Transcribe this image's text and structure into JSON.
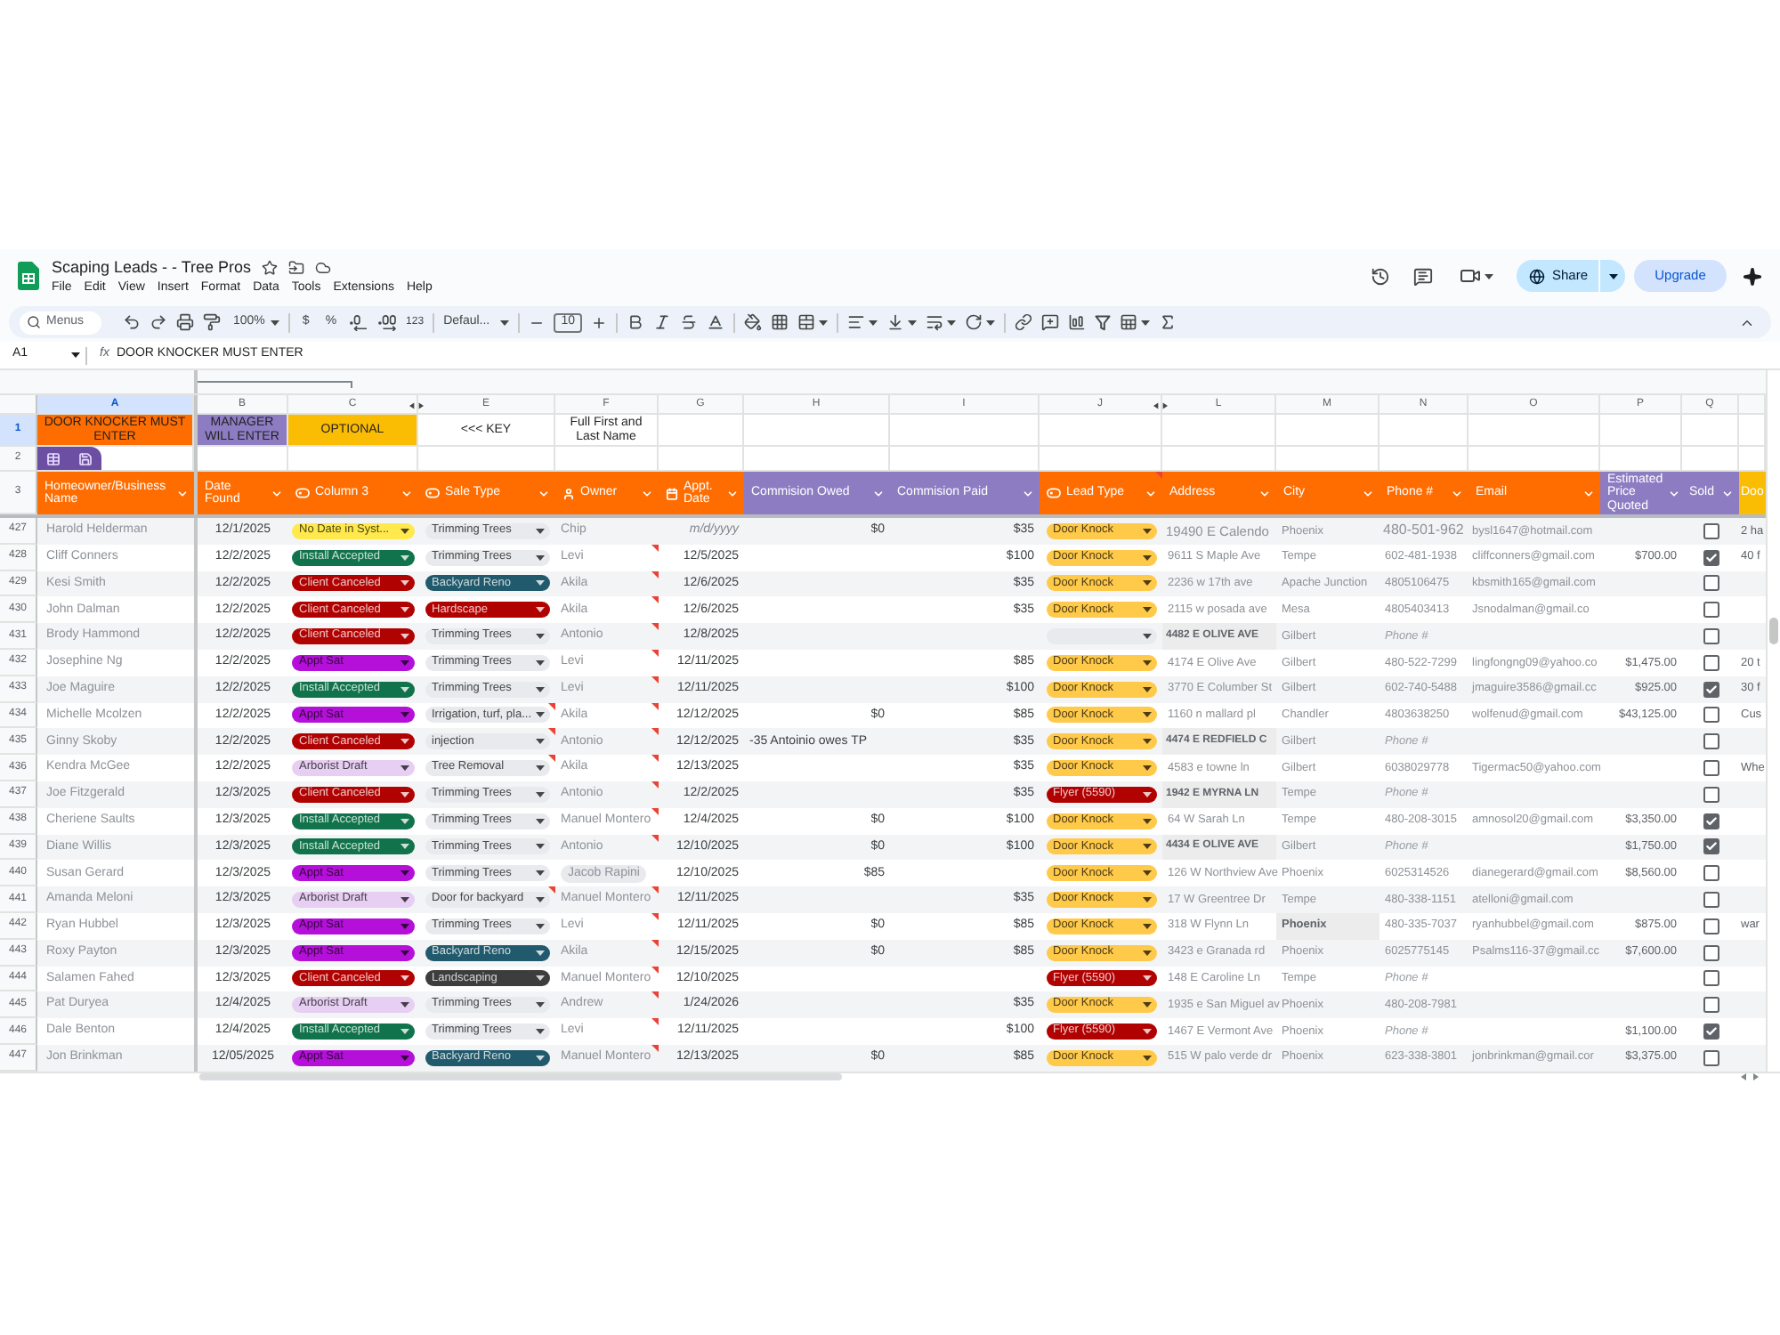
{
  "app": {
    "title": "Scaping Leads - - Tree Pros",
    "menu": [
      "File",
      "Edit",
      "View",
      "Insert",
      "Format",
      "Data",
      "Tools",
      "Extensions",
      "Help"
    ],
    "share": "Share",
    "upgrade": "Upgrade"
  },
  "toolbar": {
    "search": {
      "placeholder": "Menus"
    },
    "zoom": "100%",
    "currency": "$",
    "percent": "%",
    "number_format": "123",
    "font": "Defaul...",
    "font_size": "10"
  },
  "formula_bar": {
    "cell": "A1",
    "function_label": "fx",
    "content": "DOOR KNOCKER MUST ENTER"
  },
  "columns": [
    {
      "letter": "A",
      "selected": true,
      "hidden_after": false
    },
    {
      "letter": "B",
      "selected": false,
      "hidden_after": false
    },
    {
      "letter": "C",
      "selected": false,
      "hidden_after": true
    },
    {
      "letter": "E",
      "selected": false,
      "hidden_after": false
    },
    {
      "letter": "F",
      "selected": false,
      "hidden_after": false
    },
    {
      "letter": "G",
      "selected": false,
      "hidden_after": false
    },
    {
      "letter": "H",
      "selected": false,
      "hidden_after": false
    },
    {
      "letter": "I",
      "selected": false,
      "hidden_after": false
    },
    {
      "letter": "J",
      "selected": false,
      "hidden_after": true
    },
    {
      "letter": "L",
      "selected": false,
      "hidden_after": false
    },
    {
      "letter": "M",
      "selected": false,
      "hidden_after": false
    },
    {
      "letter": "N",
      "selected": false,
      "hidden_after": false
    },
    {
      "letter": "O",
      "selected": false,
      "hidden_after": false
    },
    {
      "letter": "P",
      "selected": false,
      "hidden_after": false
    },
    {
      "letter": "Q",
      "selected": false,
      "hidden_after": false
    }
  ],
  "key_row": {
    "number": "1",
    "selected": true,
    "cells": [
      {
        "text": "DOOR KNOCKER MUST ENTER",
        "color": "#ff6d01"
      },
      {
        "text": "MANAGER WILL ENTER",
        "color": "#8e7cc3"
      },
      {
        "text": "OPTIONAL",
        "color": "#fbbc04"
      },
      {
        "text": "<<< KEY"
      },
      {
        "text": "Full First and Last Name"
      }
    ]
  },
  "spacer_row": {
    "number": "2",
    "selected": false
  },
  "header_row": {
    "number": "3",
    "selected": false,
    "cells": [
      {
        "label": "Homeowner/Business Name",
        "color": "#ff6d01",
        "kind": "plain",
        "note": false,
        "dropdown": true
      },
      {
        "label": "Date Found",
        "color": "#ff6d01",
        "kind": "plain",
        "note": false,
        "dropdown": true
      },
      {
        "label": "Column 3",
        "color": "#ff6d01",
        "kind": "chip",
        "note": false,
        "dropdown": true
      },
      {
        "label": "Sale Type",
        "color": "#ff6d01",
        "kind": "chip",
        "note": false,
        "dropdown": true
      },
      {
        "label": "Owner",
        "color": "#ff6d01",
        "kind": "person",
        "note": false,
        "dropdown": true
      },
      {
        "label": "Appt. Date",
        "color": "#ff6d01",
        "kind": "calendar",
        "note": false,
        "dropdown": true
      },
      {
        "label": "Commision Owed",
        "color": "#8e7cc3",
        "kind": "plain",
        "note": false,
        "dropdown": true
      },
      {
        "label": "Commision Paid",
        "color": "#8e7cc3",
        "kind": "plain",
        "note": false,
        "dropdown": true
      },
      {
        "label": "Lead Type",
        "color": "#ff6d01",
        "kind": "chip",
        "note": true,
        "dropdown": true
      },
      {
        "label": "Address",
        "color": "#ff6d01",
        "kind": "plain",
        "note": false,
        "dropdown": true
      },
      {
        "label": "City",
        "color": "#ff6d01",
        "kind": "plain",
        "note": false,
        "dropdown": true
      },
      {
        "label": "Phone #",
        "color": "#ff6d01",
        "kind": "plain",
        "note": false,
        "dropdown": true
      },
      {
        "label": "Email",
        "color": "#ff6d01",
        "kind": "plain",
        "note": false,
        "dropdown": true
      },
      {
        "label": "Estimated Price Quoted",
        "color": "#8e7cc3",
        "kind": "plain",
        "note": false,
        "dropdown": true
      },
      {
        "label": "Sold",
        "color": "#8e7cc3",
        "kind": "plain",
        "note": false,
        "dropdown": true
      },
      {
        "label": "Doo",
        "color": "#fbbc04",
        "kind": "plain",
        "note": false,
        "dropdown": false
      }
    ]
  },
  "rows": [
    {
      "number": "427",
      "selected": false,
      "name": "Harold Helderman",
      "date_found": "12/1/2025",
      "status": {
        "label": "No Date in Syst...",
        "color": "#ffe94d"
      },
      "sale_type": {
        "label": "Trimming Trees",
        "color": "#e8eaed"
      },
      "sale_note": false,
      "owner": {
        "name": "Chip",
        "kind": "text"
      },
      "owner_note": false,
      "appt_date": {
        "text": "m/d/yyyy",
        "kind": "hint"
      },
      "owed": {
        "text": "$0",
        "kind": "number"
      },
      "paid": "$35",
      "lead_type": {
        "label": "Door Knock",
        "color": "#ffc94a"
      },
      "address": {
        "text": "19490 E Calendo",
        "kind": "large"
      },
      "city": {
        "text": "Phoenix",
        "kind": "plain"
      },
      "phone": {
        "text": "480-501-962",
        "kind": "large"
      },
      "email": "bysl1647@hotmail.com",
      "sold": false,
      "notes": "2 ha"
    },
    {
      "number": "428",
      "selected": false,
      "name": "Cliff Conners",
      "date_found": "12/2/2025",
      "status": {
        "label": "Install Accepted",
        "color": "#11734b"
      },
      "sale_type": {
        "label": "Trimming Trees",
        "color": "#e8eaed"
      },
      "sale_note": false,
      "owner": {
        "name": "Levi",
        "kind": "text"
      },
      "owner_note": true,
      "appt_date": {
        "text": "12/5/2025",
        "kind": "date"
      },
      "paid": "$100",
      "lead_type": {
        "label": "Door Knock",
        "color": "#ffc94a"
      },
      "address": {
        "text": "9611 S Maple Ave",
        "kind": "plain"
      },
      "city": {
        "text": "Tempe",
        "kind": "plain"
      },
      "phone": {
        "text": "602-481-1938",
        "kind": "plain"
      },
      "email": "cliffconners@gmail.com",
      "price": "$700.00",
      "sold": true,
      "notes": "40 f"
    },
    {
      "number": "429",
      "selected": false,
      "name": "Kesi Smith",
      "date_found": "12/2/2025",
      "status": {
        "label": "Client Canceled",
        "color": "#b10202"
      },
      "sale_type": {
        "label": "Backyard Reno",
        "color": "#215a6c"
      },
      "sale_note": false,
      "owner": {
        "name": "Akila",
        "kind": "text"
      },
      "owner_note": true,
      "appt_date": {
        "text": "12/6/2025",
        "kind": "date"
      },
      "paid": "$35",
      "lead_type": {
        "label": "Door Knock",
        "color": "#ffc94a"
      },
      "address": {
        "text": "2236 w 17th ave",
        "kind": "plain"
      },
      "city": {
        "text": "Apache Junction",
        "kind": "plain"
      },
      "phone": {
        "text": "4805106475",
        "kind": "plain"
      },
      "email": "kbsmith165@gmail.com",
      "sold": false
    },
    {
      "number": "430",
      "selected": false,
      "name": "John Dalman",
      "date_found": "12/2/2025",
      "status": {
        "label": "Client Canceled",
        "color": "#b10202"
      },
      "sale_type": {
        "label": "Hardscape",
        "color": "#b10202"
      },
      "sale_note": false,
      "owner": {
        "name": "Akila",
        "kind": "text"
      },
      "owner_note": true,
      "appt_date": {
        "text": "12/6/2025",
        "kind": "date"
      },
      "paid": "$35",
      "lead_type": {
        "label": "Door Knock",
        "color": "#ffc94a"
      },
      "address": {
        "text": "2115 w posada ave",
        "kind": "plain"
      },
      "city": {
        "text": "Mesa",
        "kind": "plain"
      },
      "phone": {
        "text": "4805403413",
        "kind": "plain"
      },
      "email": "Jsnodalman@gmail.co",
      "sold": false
    },
    {
      "number": "431",
      "selected": false,
      "name": "Brody Hammond",
      "date_found": "12/2/2025",
      "status": {
        "label": "Client Canceled",
        "color": "#b10202"
      },
      "sale_type": {
        "label": "Trimming Trees",
        "color": "#e8eaed"
      },
      "sale_note": false,
      "owner": {
        "name": "Antonio",
        "kind": "text"
      },
      "owner_note": true,
      "appt_date": {
        "text": "12/8/2025",
        "kind": "date"
      },
      "lead_type": {
        "color": "#e8eaed"
      },
      "address": {
        "text": "4482 E OLIVE AVE",
        "kind": "bold"
      },
      "city": {
        "text": "Gilbert",
        "kind": "plain"
      },
      "phone": {
        "text": "Phone #",
        "kind": "hint"
      },
      "sold": false
    },
    {
      "number": "432",
      "selected": false,
      "name": "Josephine Ng",
      "date_found": "12/2/2025",
      "status": {
        "label": "Appt Sat",
        "color": "#b410d9"
      },
      "sale_type": {
        "label": "Trimming Trees",
        "color": "#e8eaed"
      },
      "sale_note": false,
      "owner": {
        "name": "Levi",
        "kind": "text"
      },
      "owner_note": true,
      "appt_date": {
        "text": "12/11/2025",
        "kind": "date"
      },
      "paid": "$85",
      "lead_type": {
        "label": "Door Knock",
        "color": "#ffc94a"
      },
      "address": {
        "text": "4174 E Olive Ave",
        "kind": "plain"
      },
      "city": {
        "text": "Gilbert",
        "kind": "plain"
      },
      "phone": {
        "text": "480-522-7299",
        "kind": "plain"
      },
      "email": "lingfongng09@yahoo.co",
      "price": "$1,475.00",
      "sold": false,
      "notes": "20 t"
    },
    {
      "number": "433",
      "selected": false,
      "name": "Joe Maguire",
      "date_found": "12/2/2025",
      "status": {
        "label": "Install Accepted",
        "color": "#11734b"
      },
      "sale_type": {
        "label": "Trimming Trees",
        "color": "#e8eaed"
      },
      "sale_note": false,
      "owner": {
        "name": "Levi",
        "kind": "text"
      },
      "owner_note": true,
      "appt_date": {
        "text": "12/11/2025",
        "kind": "date"
      },
      "paid": "$100",
      "lead_type": {
        "label": "Door Knock",
        "color": "#ffc94a"
      },
      "address": {
        "text": "3770 E Columber St",
        "kind": "plain"
      },
      "city": {
        "text": "Gilbert",
        "kind": "plain"
      },
      "phone": {
        "text": "602-740-5488",
        "kind": "plain"
      },
      "email": "jmaguire3586@gmail.cc",
      "price": "$925.00",
      "sold": true,
      "notes": "30 f"
    },
    {
      "number": "434",
      "selected": false,
      "name": "Michelle Mcolzen",
      "date_found": "12/2/2025",
      "status": {
        "label": "Appt Sat",
        "color": "#b410d9"
      },
      "sale_type": {
        "label": "Irrigation, turf, pla...",
        "color": "#e8eaed"
      },
      "sale_note": true,
      "owner": {
        "name": "Akila",
        "kind": "text"
      },
      "owner_note": true,
      "appt_date": {
        "text": "12/12/2025",
        "kind": "date"
      },
      "owed": {
        "text": "$0",
        "kind": "number"
      },
      "paid": "$85",
      "lead_type": {
        "label": "Door Knock",
        "color": "#ffc94a"
      },
      "address": {
        "text": "1160 n mallard pl",
        "kind": "plain"
      },
      "city": {
        "text": "Chandler",
        "kind": "plain"
      },
      "phone": {
        "text": "4803638250",
        "kind": "plain"
      },
      "email": "wolfenud@gmail.com",
      "price": "$43,125.00",
      "sold": false,
      "notes": "Cus"
    },
    {
      "number": "435",
      "selected": false,
      "name": "Ginny Skoby",
      "date_found": "12/2/2025",
      "status": {
        "label": "Client Canceled",
        "color": "#b10202"
      },
      "sale_type": {
        "label": "injection",
        "color": "#e8eaed"
      },
      "sale_note": true,
      "owner": {
        "name": "Antonio",
        "kind": "text"
      },
      "owner_note": true,
      "appt_date": {
        "text": "12/12/2025",
        "kind": "date"
      },
      "owed": {
        "text": "-35 Antoinio owes TP",
        "kind": "text"
      },
      "paid": "$35",
      "lead_type": {
        "label": "Door Knock",
        "color": "#ffc94a"
      },
      "address": {
        "text": "4474 E REDFIELD C",
        "kind": "bold"
      },
      "city": {
        "text": "Gilbert",
        "kind": "plain"
      },
      "phone": {
        "text": "Phone #",
        "kind": "hint"
      },
      "sold": false
    },
    {
      "number": "436",
      "selected": false,
      "name": "Kendra McGee",
      "date_found": "12/2/2025",
      "status": {
        "label": "Arborist Draft",
        "color": "#e6cff2"
      },
      "sale_type": {
        "label": "Tree Removal",
        "color": "#e8eaed"
      },
      "sale_note": true,
      "owner": {
        "name": "Akila",
        "kind": "text"
      },
      "owner_note": true,
      "appt_date": {
        "text": "12/13/2025",
        "kind": "date"
      },
      "paid": "$35",
      "lead_type": {
        "label": "Door Knock",
        "color": "#ffc94a"
      },
      "address": {
        "text": "4583 e towne ln",
        "kind": "plain"
      },
      "city": {
        "text": "Gilbert",
        "kind": "plain"
      },
      "phone": {
        "text": "6038029778",
        "kind": "plain"
      },
      "email": "Tigermac50@yahoo.com",
      "sold": false,
      "notes": "Whe"
    },
    {
      "number": "437",
      "selected": false,
      "name": "Joe Fitzgerald",
      "date_found": "12/3/2025",
      "status": {
        "label": "Client Canceled",
        "color": "#b10202"
      },
      "sale_type": {
        "label": "Trimming Trees",
        "color": "#e8eaed"
      },
      "sale_note": false,
      "owner": {
        "name": "Antonio",
        "kind": "text"
      },
      "owner_note": true,
      "appt_date": {
        "text": "12/2/2025",
        "kind": "date"
      },
      "paid": "$35",
      "lead_type": {
        "label": "Flyer (5590)",
        "color": "#b10202"
      },
      "address": {
        "text": "1942 E MYRNA LN",
        "kind": "bold"
      },
      "city": {
        "text": "Tempe",
        "kind": "plain"
      },
      "phone": {
        "text": "Phone #",
        "kind": "hint"
      },
      "sold": false
    },
    {
      "number": "438",
      "selected": false,
      "name": "Cheriene Saults",
      "date_found": "12/3/2025",
      "status": {
        "label": "Install Accepted",
        "color": "#11734b"
      },
      "sale_type": {
        "label": "Trimming Trees",
        "color": "#e8eaed"
      },
      "sale_note": false,
      "owner": {
        "name": "Manuel Montero",
        "kind": "text"
      },
      "owner_note": true,
      "appt_date": {
        "text": "12/4/2025",
        "kind": "date"
      },
      "owed": {
        "text": "$0",
        "kind": "number"
      },
      "paid": "$100",
      "lead_type": {
        "label": "Door Knock",
        "color": "#ffc94a"
      },
      "address": {
        "text": "64 W Sarah Ln",
        "kind": "plain"
      },
      "city": {
        "text": "Tempe",
        "kind": "plain"
      },
      "phone": {
        "text": "480-208-3015",
        "kind": "plain"
      },
      "email": "amnosol20@gmail.com",
      "price": "$3,350.00",
      "sold": true
    },
    {
      "number": "439",
      "selected": false,
      "name": "Diane Willis",
      "date_found": "12/3/2025",
      "status": {
        "label": "Install Accepted",
        "color": "#11734b"
      },
      "sale_type": {
        "label": "Trimming Trees",
        "color": "#e8eaed"
      },
      "sale_note": false,
      "owner": {
        "name": "Antonio",
        "kind": "text"
      },
      "owner_note": true,
      "appt_date": {
        "text": "12/10/2025",
        "kind": "date"
      },
      "owed": {
        "text": "$0",
        "kind": "number"
      },
      "paid": "$100",
      "lead_type": {
        "label": "Door Knock",
        "color": "#ffc94a"
      },
      "address": {
        "text": "4434 E OLIVE AVE",
        "kind": "bold"
      },
      "city": {
        "text": "Gilbert",
        "kind": "plain"
      },
      "phone": {
        "text": "Phone #",
        "kind": "hint"
      },
      "price": "$1,750.00",
      "sold": true
    },
    {
      "number": "440",
      "selected": false,
      "name": "Susan Gerard",
      "date_found": "12/3/2025",
      "status": {
        "label": "Appt Sat",
        "color": "#b410d9"
      },
      "sale_type": {
        "label": "Trimming Trees",
        "color": "#e8eaed"
      },
      "sale_note": false,
      "owner": {
        "name": "Jacob Rapini",
        "kind": "chip"
      },
      "owner_note": false,
      "appt_date": {
        "text": "12/10/2025",
        "kind": "date"
      },
      "owed": {
        "text": "$85",
        "kind": "number"
      },
      "lead_type": {
        "label": "Door Knock",
        "color": "#ffc94a"
      },
      "address": {
        "text": "126 W Northview Ave",
        "kind": "plain"
      },
      "city": {
        "text": "Phoenix",
        "kind": "plain"
      },
      "phone": {
        "text": "6025314526",
        "kind": "plain"
      },
      "email": "dianegerard@gmail.com",
      "price": "$8,560.00",
      "sold": false
    },
    {
      "number": "441",
      "selected": false,
      "name": "Amanda Meloni",
      "date_found": "12/3/2025",
      "status": {
        "label": "Arborist Draft",
        "color": "#e6cff2"
      },
      "sale_type": {
        "label": "Door for backyard",
        "color": "#e8eaed"
      },
      "sale_note": true,
      "owner": {
        "name": "Manuel Montero",
        "kind": "text"
      },
      "owner_note": true,
      "appt_date": {
        "text": "12/11/2025",
        "kind": "date"
      },
      "paid": "$35",
      "lead_type": {
        "label": "Door Knock",
        "color": "#ffc94a"
      },
      "address": {
        "text": "17 W Greentree Dr",
        "kind": "plain"
      },
      "city": {
        "text": "Tempe",
        "kind": "plain"
      },
      "phone": {
        "text": "480-338-1151",
        "kind": "plain"
      },
      "email": "atelloni@gmail.com",
      "sold": false
    },
    {
      "number": "442",
      "selected": false,
      "name": "Ryan Hubbel",
      "date_found": "12/3/2025",
      "status": {
        "label": "Appt Sat",
        "color": "#b410d9"
      },
      "sale_type": {
        "label": "Trimming Trees",
        "color": "#e8eaed"
      },
      "sale_note": false,
      "owner": {
        "name": "Levi",
        "kind": "text"
      },
      "owner_note": true,
      "appt_date": {
        "text": "12/11/2025",
        "kind": "date"
      },
      "owed": {
        "text": "$0",
        "kind": "number"
      },
      "paid": "$85",
      "lead_type": {
        "label": "Door Knock",
        "color": "#ffc94a"
      },
      "address": {
        "text": "318 W Flynn Ln",
        "kind": "plain"
      },
      "city": {
        "text": "Phoenix",
        "kind": "bold"
      },
      "phone": {
        "text": "480-335-7037",
        "kind": "plain"
      },
      "email": "ryanhubbel@gmail.com",
      "price": "$875.00",
      "sold": false,
      "notes": "war"
    },
    {
      "number": "443",
      "selected": false,
      "name": "Roxy Payton",
      "date_found": "12/3/2025",
      "status": {
        "label": "Appt Sat",
        "color": "#b410d9"
      },
      "sale_type": {
        "label": "Backyard Reno",
        "color": "#215a6c"
      },
      "sale_note": false,
      "owner": {
        "name": "Akila",
        "kind": "text"
      },
      "owner_note": true,
      "appt_date": {
        "text": "12/15/2025",
        "kind": "date"
      },
      "owed": {
        "text": "$0",
        "kind": "number"
      },
      "paid": "$85",
      "lead_type": {
        "label": "Door Knock",
        "color": "#ffc94a"
      },
      "address": {
        "text": "3423 e Granada rd",
        "kind": "plain"
      },
      "city": {
        "text": "Phoenix",
        "kind": "plain"
      },
      "phone": {
        "text": "6025775145",
        "kind": "plain"
      },
      "email": "Psalms116-37@gmail.cc",
      "price": "$7,600.00",
      "sold": false
    },
    {
      "number": "444",
      "selected": false,
      "name": "Salamen Fahed",
      "date_found": "12/3/2025",
      "status": {
        "label": "Client Canceled",
        "color": "#b10202"
      },
      "sale_type": {
        "label": "Landscaping",
        "color": "#3d3d3d"
      },
      "sale_note": false,
      "owner": {
        "name": "Manuel Montero",
        "kind": "text"
      },
      "owner_note": true,
      "appt_date": {
        "text": "12/10/2025",
        "kind": "date"
      },
      "lead_type": {
        "label": "Flyer (5590)",
        "color": "#b10202"
      },
      "address": {
        "text": "148 E Caroline Ln",
        "kind": "plain"
      },
      "city": {
        "text": "Tempe",
        "kind": "plain"
      },
      "phone": {
        "text": "Phone #",
        "kind": "hint"
      },
      "sold": false
    },
    {
      "number": "445",
      "selected": false,
      "name": "Pat Duryea",
      "date_found": "12/4/2025",
      "status": {
        "label": "Arborist Draft",
        "color": "#e6cff2"
      },
      "sale_type": {
        "label": "Trimming Trees",
        "color": "#e8eaed"
      },
      "sale_note": false,
      "owner": {
        "name": "Andrew",
        "kind": "text"
      },
      "owner_note": true,
      "appt_date": {
        "text": "1/24/2026",
        "kind": "date"
      },
      "paid": "$35",
      "lead_type": {
        "label": "Door Knock",
        "color": "#ffc94a"
      },
      "address": {
        "text": "1935 e San Miguel av",
        "kind": "plain"
      },
      "city": {
        "text": "Phoenix",
        "kind": "plain"
      },
      "phone": {
        "text": "480-208-7981",
        "kind": "plain"
      },
      "sold": false
    },
    {
      "number": "446",
      "selected": false,
      "name": "Dale Benton",
      "date_found": "12/4/2025",
      "status": {
        "label": "Install Accepted",
        "color": "#11734b"
      },
      "sale_type": {
        "label": "Trimming Trees",
        "color": "#e8eaed"
      },
      "sale_note": false,
      "owner": {
        "name": "Levi",
        "kind": "text"
      },
      "owner_note": true,
      "appt_date": {
        "text": "12/11/2025",
        "kind": "date"
      },
      "paid": "$100",
      "lead_type": {
        "label": "Flyer (5590)",
        "color": "#b10202"
      },
      "address": {
        "text": "1467 E Vermont Ave",
        "kind": "plain"
      },
      "city": {
        "text": "Phoenix",
        "kind": "plain"
      },
      "phone": {
        "text": "Phone #",
        "kind": "hint"
      },
      "price": "$1,100.00",
      "sold": true
    },
    {
      "number": "447",
      "selected": false,
      "name": "Jon Brinkman",
      "date_found": "12/05/2025",
      "status": {
        "label": "Appt Sat",
        "color": "#b410d9"
      },
      "sale_type": {
        "label": "Backyard Reno",
        "color": "#215a6c"
      },
      "sale_note": false,
      "owner": {
        "name": "Manuel Montero",
        "kind": "text"
      },
      "owner_note": true,
      "appt_date": {
        "text": "12/13/2025",
        "kind": "date"
      },
      "owed": {
        "text": "$0",
        "kind": "number"
      },
      "paid": "$85",
      "lead_type": {
        "label": "Door Knock",
        "color": "#ffc94a"
      },
      "address": {
        "text": "515 W palo verde dr",
        "kind": "plain"
      },
      "city": {
        "text": "Phoenix",
        "kind": "plain"
      },
      "phone": {
        "text": "623-338-3801",
        "kind": "plain"
      },
      "email": "jonbrinkman@gmail.cor",
      "price": "$3,375.00",
      "sold": false
    }
  ]
}
